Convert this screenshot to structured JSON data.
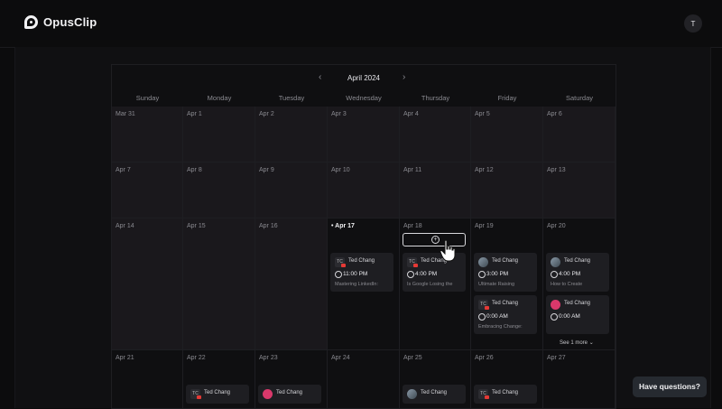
{
  "app": {
    "name": "OpusClip",
    "user_initial": "T"
  },
  "calendar": {
    "month_title": "April 2024",
    "prev_icon": "chevron-left-icon",
    "next_icon": "chevron-right-icon",
    "weekdays": [
      "Sunday",
      "Monday",
      "Tuesday",
      "Wednesday",
      "Thursday",
      "Friday",
      "Saturday"
    ],
    "today": "Apr 17",
    "weeks": [
      [
        "Mar 31",
        "Apr 1",
        "Apr 2",
        "Apr 3",
        "Apr 4",
        "Apr 5",
        "Apr 6"
      ],
      [
        "Apr 7",
        "Apr 8",
        "Apr 9",
        "Apr 10",
        "Apr 11",
        "Apr 12",
        "Apr 13"
      ],
      [
        "Apr 14",
        "Apr 15",
        "Apr 16",
        "Apr 17",
        "Apr 18",
        "Apr 19",
        "Apr 20"
      ],
      [
        "Apr 21",
        "Apr 22",
        "Apr 23",
        "Apr 24",
        "Apr 25",
        "Apr 26",
        "Apr 27"
      ]
    ],
    "posts": {
      "wed17": {
        "author": "Ted Chang",
        "time": "11:00 PM",
        "title": "Mastering LinkedIn:"
      },
      "thu18": {
        "author": "Ted Chang",
        "time": "4:00 PM",
        "title": "Is Google Losing the"
      },
      "fri19a": {
        "author": "Ted Chang",
        "time": "3:00 PM",
        "title": "Ultimate Raising"
      },
      "fri19b": {
        "author": "Ted Chang",
        "time": "0:00 AM",
        "title": "Embracing Change:"
      },
      "sat20a": {
        "author": "Ted Chang",
        "time": "4:00 PM",
        "title": "How to Create"
      },
      "sat20b": {
        "author": "Ted Chang",
        "time": "0:00 AM"
      },
      "mon22": {
        "author": "Ted Chang"
      },
      "tue23": {
        "author": "Ted Chang"
      },
      "thu25": {
        "author": "Ted Chang"
      },
      "fri26": {
        "author": "Ted Chang"
      }
    },
    "see_more": "See 1 more"
  },
  "help": {
    "label": "Have questions?"
  }
}
